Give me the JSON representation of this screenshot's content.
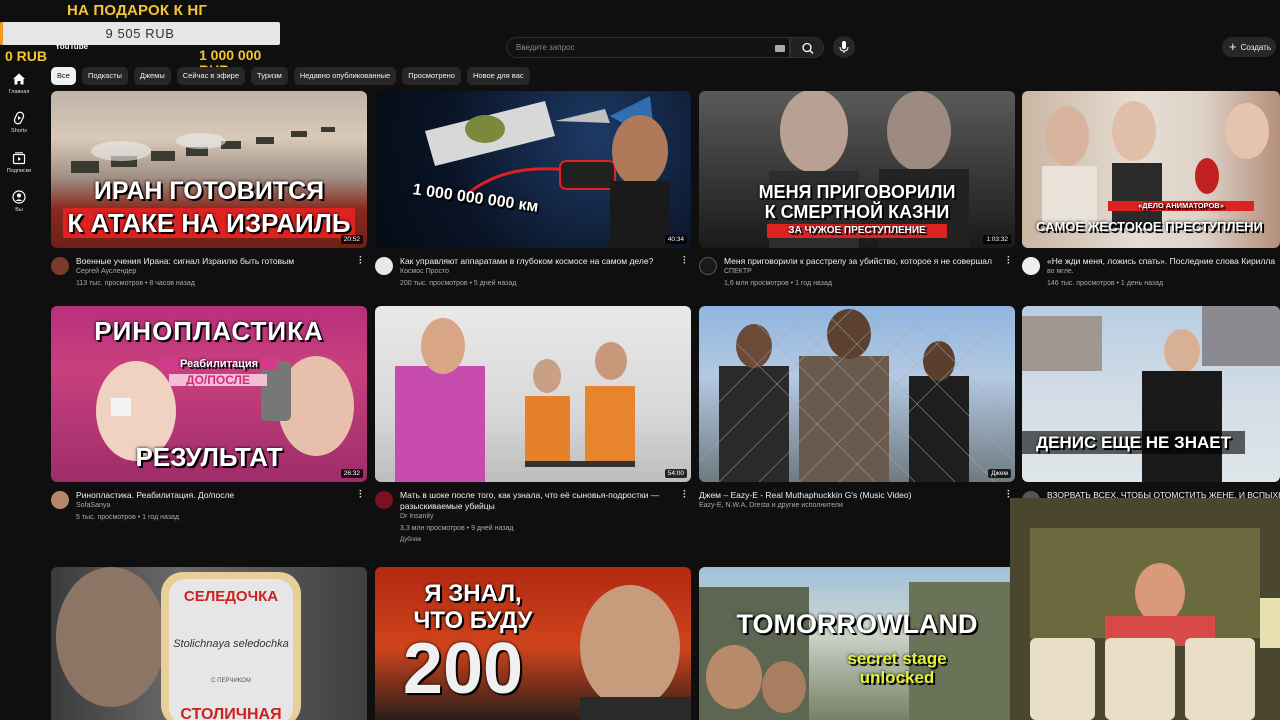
{
  "donation": {
    "title": "НА ПОДАРОК К НГ",
    "current": "9 505 RUB",
    "min": "0 RUB",
    "max": "1 000 000 RUB",
    "progress_fraction": 0.0095
  },
  "header": {
    "logo": "YouTube",
    "search_placeholder": "Введите запрос",
    "create_label": "Создать"
  },
  "sidebar": {
    "items": [
      {
        "label": "Главная",
        "icon": "home-icon"
      },
      {
        "label": "Shorts",
        "icon": "shorts-icon"
      },
      {
        "label": "Подписки",
        "icon": "subscriptions-icon"
      },
      {
        "label": "Вы",
        "icon": "user-icon"
      }
    ]
  },
  "chips": [
    "Все",
    "Подкасты",
    "Джемы",
    "Сейчас в эфире",
    "Туризм",
    "Недавно опубликованные",
    "Просмотрено",
    "Новое для вас"
  ],
  "videos": [
    {
      "thumb_caption_1": "ИРАН ГОТОВИТСЯ",
      "thumb_caption_2": "К АТАКЕ НА ИЗРАИЛЬ",
      "duration": "20:52",
      "title": "Военные учения Ирана: сигнал Израилю быть готовым",
      "channel": "Сергей Ауслендер",
      "stats": "113 тыс. просмотров • 8 часов назад"
    },
    {
      "thumb_caption_1": "1 000 000 000 км",
      "duration": "40:34",
      "title": "Как управляют аппаратами в глубоком космосе на самом деле?",
      "channel": "Космос Просто",
      "stats": "200 тыс. просмотров • 5 дней назад"
    },
    {
      "thumb_caption_1": "МЕНЯ ПРИГОВОРИЛИ",
      "thumb_caption_2": "К СМЕРТНОЙ КАЗНИ",
      "thumb_caption_3": "ЗА ЧУЖОЕ ПРЕСТУПЛЕНИЕ",
      "duration": "1:03:32",
      "title": "Меня приговорили к расстрелу за убийство, которое я не совершал",
      "channel": "СПЕКТР",
      "stats": "1,6 млн просмотров • 1 год назад"
    },
    {
      "thumb_caption_1": "«ДЕЛО АНИМАТОРОВ»",
      "thumb_caption_2": "САМОЕ ЖЕСТОКОЕ ПРЕСТУПЛЕНИ",
      "title": "«Не жди меня, ложись спать». Последние слова Кирилла",
      "channel": "во мгле.",
      "stats": "146 тыс. просмотров • 1 день назад"
    },
    {
      "thumb_caption_1": "РИНОПЛАСТИКА",
      "thumb_caption_2": "Реабилитация",
      "thumb_caption_3": "ДО/ПОСЛЕ",
      "thumb_caption_4": "РЕЗУЛЬТАТ",
      "duration": "26:32",
      "title": "Ринопластика. Реабилитация. До/после",
      "channel": "SofaSanya",
      "stats": "5 тыс. просмотров • 1 год назад"
    },
    {
      "duration": "54:00",
      "title": "Мать в шоке после того, как узнала, что её сыновья-подростки — разыскиваемые убийцы",
      "channel": "Dr Insanity",
      "stats": "3,3 млн просмотров • 9 дней назад",
      "badge": "Дубляж"
    },
    {
      "duration": "Джем",
      "title": "Джем – Eazy-E - Real Muthaphuckkin G's (Music Video)",
      "channel": "Eazy-E, N.W.A, Dresta и другие исполнители"
    },
    {
      "thumb_caption_1": "ДЕНИС ЕЩЕ НЕ ЗНАЕТ",
      "title": "ВЗОРВАТЬ ВСЕХ, ЧТОБЫ ОТОМСТИТЬ ЖЕНЕ. И ВСПЫХНУ"
    },
    {
      "thumb_caption_1": "СЕЛЕДОЧКА",
      "thumb_caption_2": "Stolichnaya seledochka",
      "thumb_caption_3": "С ПЕРЧИКОМ",
      "thumb_caption_4": "СТОЛИЧНАЯ"
    },
    {
      "thumb_caption_1": "Я ЗНАЛ,",
      "thumb_caption_2": "ЧТО БУДУ",
      "thumb_caption_3": "200"
    },
    {
      "thumb_caption_1": "TOMORROWLAND",
      "thumb_caption_2": "secret stage",
      "thumb_caption_3": "unlocked"
    }
  ],
  "colors": {
    "accent": "#f5c431",
    "progress": "#f39a22",
    "bg": "#0f0f0f"
  }
}
